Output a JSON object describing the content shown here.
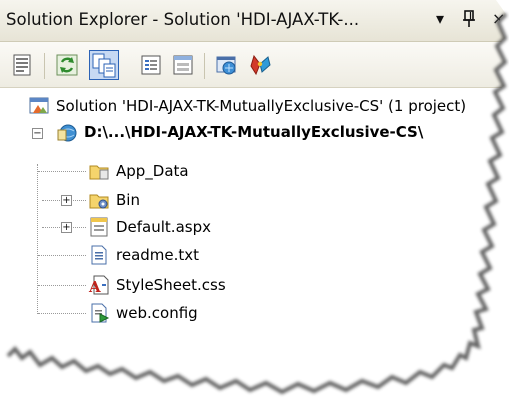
{
  "window": {
    "title": "Solution Explorer - Solution 'HDI-AJAX-TK-...",
    "dropdown_glyph": "▾",
    "pin_glyph": "ꟻ",
    "close_glyph": "×"
  },
  "toolbar": {
    "buttons": [
      {
        "name": "properties-icon"
      },
      {
        "name": "refresh-icon"
      },
      {
        "name": "show-all-files-icon",
        "active": true
      },
      {
        "name": "view-code-icon"
      },
      {
        "name": "view-designer-icon"
      },
      {
        "name": "copy-website-icon"
      },
      {
        "name": "asp-net-configuration-icon"
      }
    ]
  },
  "tree": {
    "solution": "Solution 'HDI-AJAX-TK-MutuallyExclusive-CS' (1 project)",
    "project": "D:\\...\\HDI-AJAX-TK-MutuallyExclusive-CS\\",
    "items": [
      {
        "label": "App_Data",
        "icon": "folder-icon",
        "expandable": false
      },
      {
        "label": "Bin",
        "icon": "bin-folder-icon",
        "expandable": true
      },
      {
        "label": "Default.aspx",
        "icon": "aspx-page-icon",
        "expandable": true
      },
      {
        "label": "readme.txt",
        "icon": "text-file-icon",
        "expandable": false
      },
      {
        "label": "StyleSheet.css",
        "icon": "css-file-icon",
        "expandable": false
      },
      {
        "label": "web.config",
        "icon": "config-file-icon",
        "expandable": false
      }
    ],
    "expander_collapsed": "+",
    "expander_expanded": "−"
  },
  "colors": {
    "accent": "#2b62b6",
    "titlebar": "#e7e4d6",
    "toolbar": "#eeece2"
  }
}
